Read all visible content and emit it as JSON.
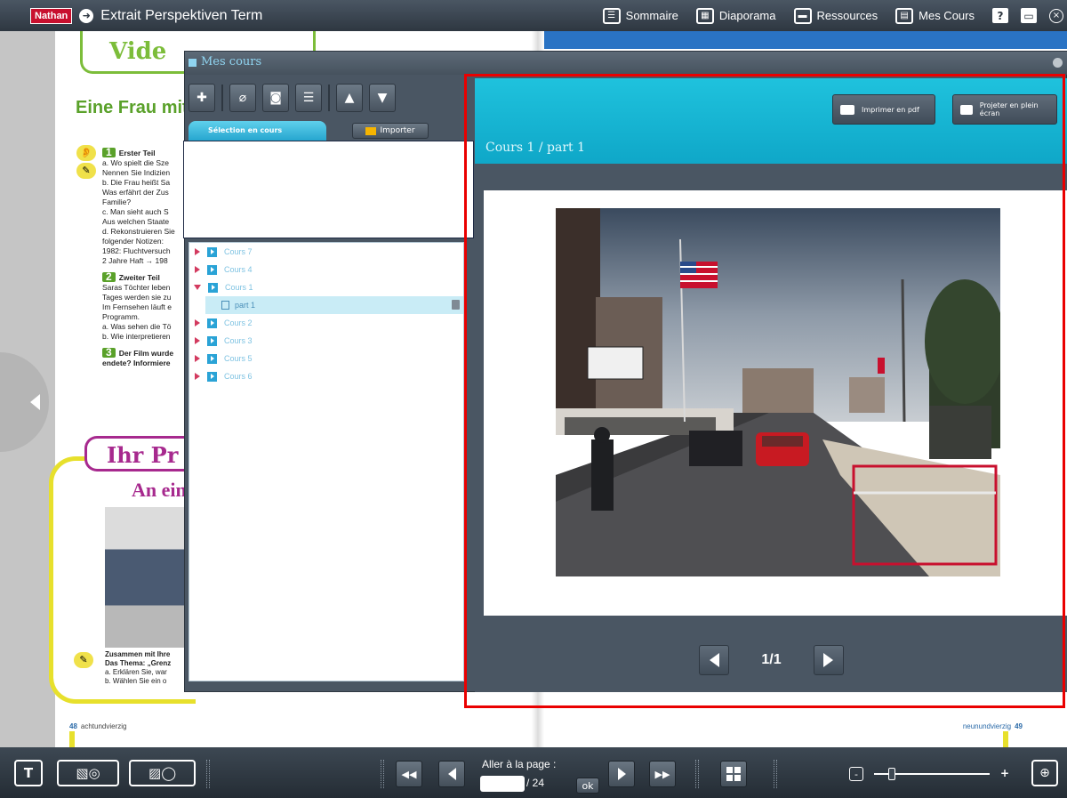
{
  "app": {
    "brand": "Nathan",
    "title": "Extrait Perspektiven Term"
  },
  "topnav": {
    "items": [
      {
        "label": "Sommaire",
        "icon": "list-icon"
      },
      {
        "label": "Diaporama",
        "icon": "grid-icon"
      },
      {
        "label": "Ressources",
        "icon": "folder-icon"
      },
      {
        "label": "Mes Cours",
        "icon": "notebook-icon"
      }
    ],
    "help": "?",
    "close": "×"
  },
  "book": {
    "tab_title": "Vide",
    "heading": "Eine Frau mit",
    "sections": [
      {
        "num": "1",
        "title": "Erster Teil",
        "lines": [
          "a. Wo spielt die Sze",
          "Nennen Sie Indizien",
          "b. Die Frau heißt Sa",
          "Was erfährt der Zus",
          "Familie?",
          "c. Man sieht auch S",
          "Aus welchen Staate",
          "d. Rekonstruieren Sie",
          "folgender Notizen:",
          "1982: Fluchtversuch",
          "2 Jahre Haft → 198"
        ]
      },
      {
        "num": "2",
        "title": "Zweiter Teil",
        "lines": [
          "Saras Töchter leben",
          "Tages werden sie zu",
          "Im Fernsehen läuft e",
          "Programm.",
          "a. Was sehen die Tö",
          "b. Wie interpretieren"
        ]
      },
      {
        "num": "3",
        "title": "Der Film wurde",
        "lines": [
          "endete? Informiere"
        ]
      }
    ],
    "ihr_title": "Ihr Pr",
    "an_ein": "An ein",
    "zusammen_lines": [
      "Zusammen mit Ihre",
      "Das Thema: „Grenz",
      "a. Erklären Sie, war",
      "b. Wählen Sie ein o"
    ],
    "page_left_num": "48",
    "page_left_word": "achtundvierzig",
    "page_right_word": "neunundvierzig",
    "page_right_num": "49"
  },
  "panel": {
    "title": "Mes cours",
    "tab_selection": "Sélection en cours",
    "import_label": "Importer",
    "tree": [
      {
        "label": "Cours 7",
        "expanded": false
      },
      {
        "label": "Cours 4",
        "expanded": false
      },
      {
        "label": "Cours 1",
        "expanded": true
      },
      {
        "label": "part 1",
        "child": true
      },
      {
        "label": "Cours 2",
        "expanded": false
      },
      {
        "label": "Cours 3",
        "expanded": false
      },
      {
        "label": "Cours 5",
        "expanded": false
      },
      {
        "label": "Cours 6",
        "expanded": false
      }
    ]
  },
  "course_view": {
    "print_label": "Imprimer en pdf",
    "project_label": "Projeter en plein écran",
    "breadcrumb": "Cours 1 / part 1",
    "pager": "1/1"
  },
  "bottombar": {
    "goto_label": "Aller à la page :",
    "page_value": "",
    "page_total": "/ 24",
    "ok_label": "ok",
    "zoom_minus": "-",
    "zoom_plus": "+",
    "zoom_level": 0.15
  }
}
